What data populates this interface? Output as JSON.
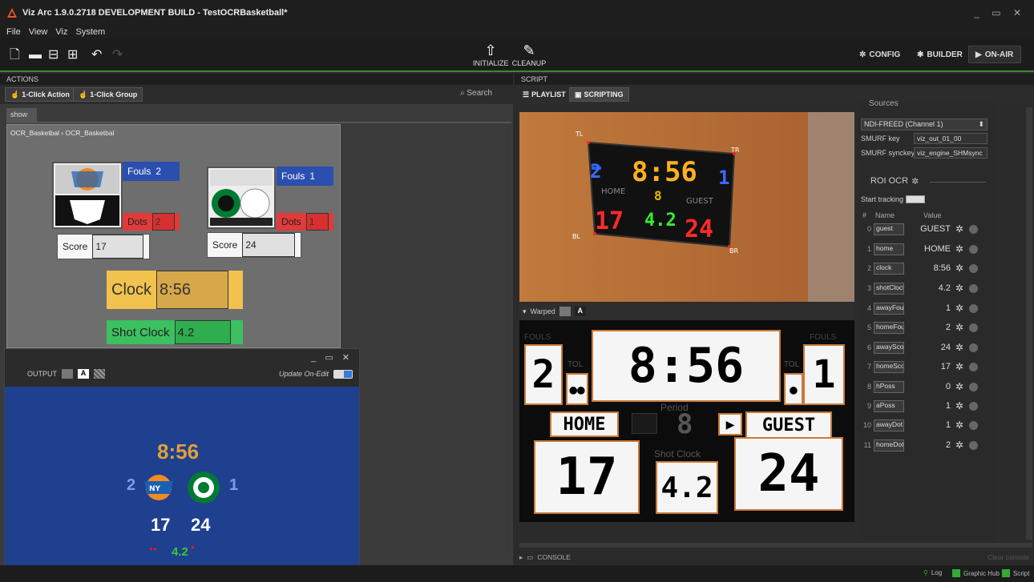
{
  "window": {
    "title": "Viz Arc 1.9.0.2718 DEVELOPMENT BUILD - TestOCRBasketball*",
    "controls": "_ ▭ ✕"
  },
  "menu": [
    "File",
    "View",
    "Viz",
    "System"
  ],
  "toolbar": {
    "initialize_label": "INITIALIZE",
    "cleanup_label": "CLEANUP",
    "config_label": "CONFIG",
    "builder_label": "BUILDER",
    "onair_label": "ON-AIR"
  },
  "actions": {
    "header": "ACTIONS",
    "one_click_action": "1-Click Action",
    "one_click_group": "1-Click Group",
    "search_label": "Search",
    "tab": "show",
    "breadcrumb": "OCR_Basketbal › OCR_Basketbal",
    "home_team": {
      "fouls_label": "Fouls",
      "fouls": "2",
      "dots_label": "Dots",
      "dots": "2",
      "score_label": "Score",
      "score": "17"
    },
    "guest_team": {
      "fouls_label": "Fouls",
      "fouls": "1",
      "dots_label": "Dots",
      "dots": "1",
      "score_label": "Score",
      "score": "24"
    },
    "clock_label": "Clock",
    "clock": "8:56",
    "shot_clock_label": "Shot Clock",
    "shot_clock": "4.2"
  },
  "output": {
    "controls": "_ ▭ ✕",
    "label": "OUTPUT",
    "update_on_edit": "Update On-Edit",
    "clock": "8:56",
    "home_fouls": "2",
    "guest_fouls": "1",
    "home_score": "17",
    "guest_score": "24",
    "shot_clock": "4.2",
    "colors": {
      "background": "#1f3f8f",
      "clock": "#e0a03a",
      "fouls": "#7e9cf0",
      "shot_clock": "#33cc33"
    }
  },
  "script": {
    "header": "SCRIPT",
    "tab_playlist": "PLAYLIST",
    "tab_scripting": "SCRIPTING",
    "camera_labels": {
      "tl": "TL",
      "tr": "TR",
      "bl": "BL",
      "br": "BR"
    },
    "scoreboard": {
      "home_fouls": "2",
      "clock": "8:56",
      "guest_fouls": "1",
      "period": "8",
      "home_label": "HOME",
      "guest_label": "GUEST",
      "home_score": "17",
      "shot_clock": "4.2",
      "guest_score": "24"
    },
    "warped_label": "Warped",
    "warped": {
      "fouls_left": "FOULS",
      "fouls_right": "FOULS",
      "tol": "TOL",
      "period": "Period",
      "shot_clock_caption": "Shot Clock",
      "home_fouls": "2",
      "clock": "8:56",
      "guest_fouls": "1",
      "period_value": "8",
      "home_label": "HOME",
      "guest_label": "GUEST",
      "home_score": "17",
      "shot_clock": "4.2",
      "guest_score": "24"
    },
    "console_label": "CONSOLE"
  },
  "sources": {
    "header": "Sources",
    "input": "NDI-FREED (Channel 1)",
    "smurf_key_label": "SMURF key",
    "smurf_key": "viz_out_01_00",
    "smurf_synckey_label": "SMURF synckey",
    "smurf_synckey": "viz_engine_SHMsync",
    "roi_header": "ROI OCR",
    "start_tracking": "Start tracking",
    "col_num": "#",
    "col_name": "Name",
    "col_value": "Value",
    "rows": [
      {
        "idx": "0",
        "name": "guest",
        "value": "GUEST"
      },
      {
        "idx": "1",
        "name": "home",
        "value": "HOME"
      },
      {
        "idx": "2",
        "name": "clock",
        "value": "8:56"
      },
      {
        "idx": "3",
        "name": "shotClocl",
        "value": "4.2"
      },
      {
        "idx": "4",
        "name": "awayFou",
        "value": "1"
      },
      {
        "idx": "5",
        "name": "homeFou",
        "value": "2"
      },
      {
        "idx": "6",
        "name": "awayScor",
        "value": "24"
      },
      {
        "idx": "7",
        "name": "homeSco",
        "value": "17"
      },
      {
        "idx": "8",
        "name": "hPoss",
        "value": "0"
      },
      {
        "idx": "9",
        "name": "aPoss",
        "value": "1"
      },
      {
        "idx": "10",
        "name": "awayDot",
        "value": "1"
      },
      {
        "idx": "11",
        "name": "homeDot",
        "value": "2"
      }
    ]
  },
  "status": {
    "log": "Log",
    "graphic_hub": "Graphic Hub",
    "script": "Script",
    "clear_console": "Clear console"
  }
}
